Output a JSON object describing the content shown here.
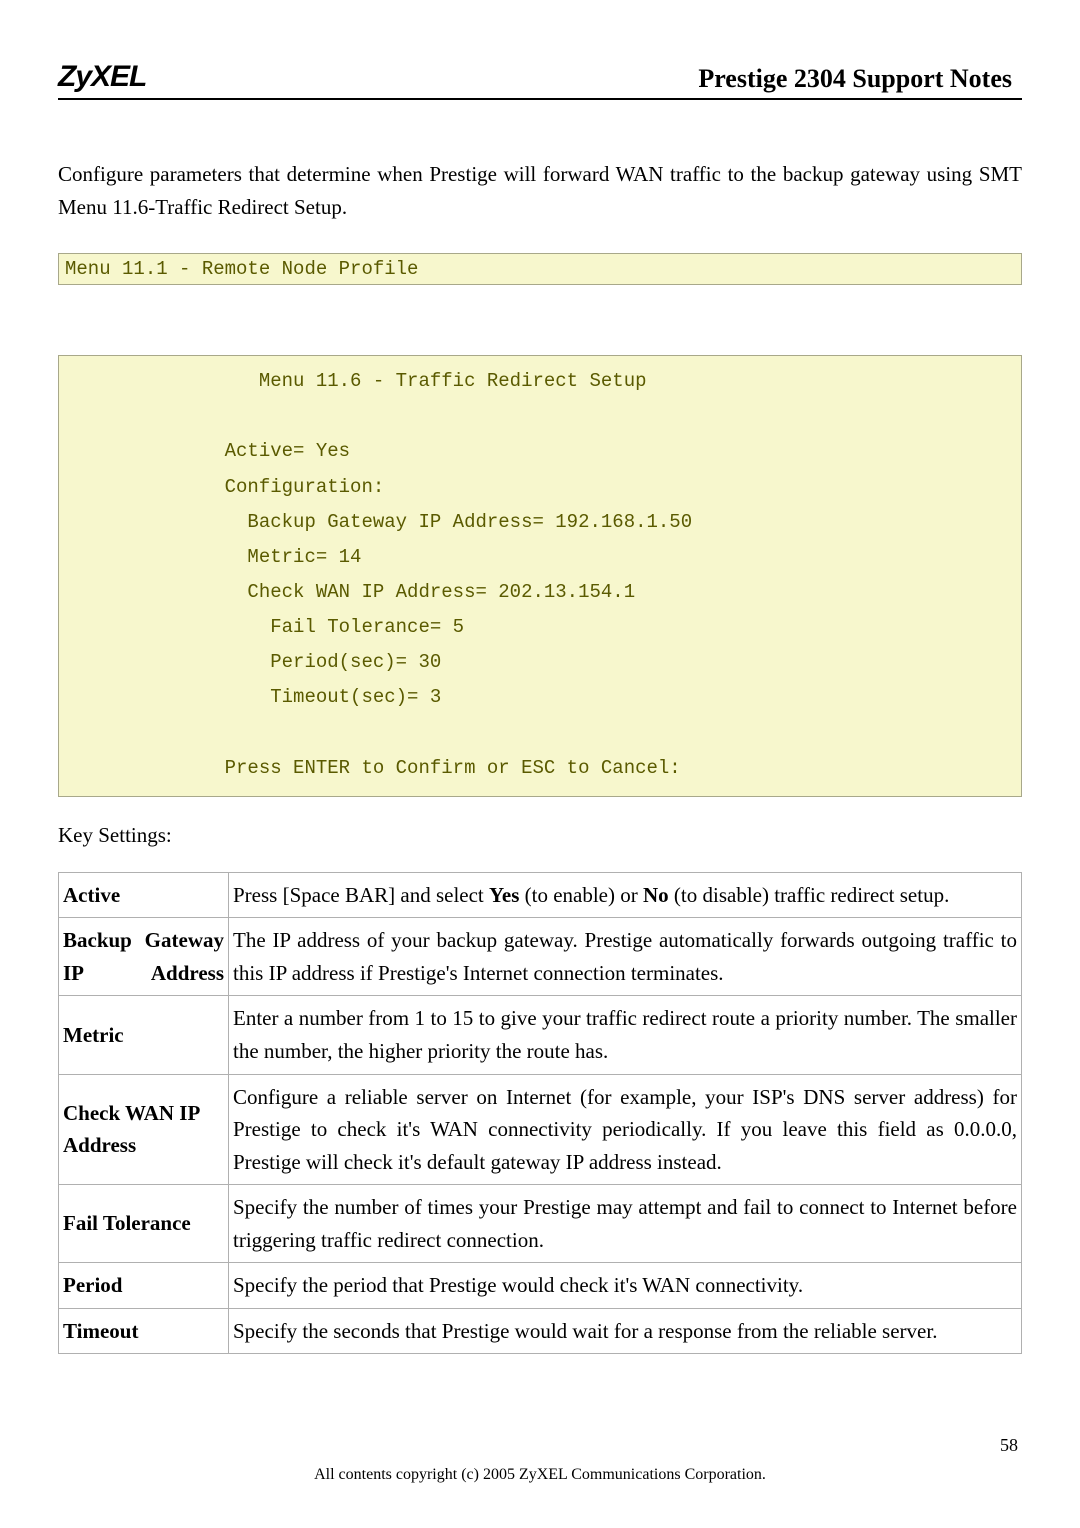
{
  "header": {
    "logo": "ZyXEL",
    "title": "Prestige 2304 Support Notes"
  },
  "intro": {
    "line1": "Configure parameters that determine when Prestige will forward WAN traffic to the backup gateway using ",
    "line2_bold": "SMT Menu 11.6-Traffic Redirect Setup."
  },
  "code_strip": "Menu 11.1 - Remote Node Profile",
  "code_block": "                 Menu 11.6 - Traffic Redirect Setup\n\n              Active= Yes\n              Configuration:\n                Backup Gateway IP Address= 192.168.1.50\n                Metric= 14\n                Check WAN IP Address= 202.13.154.1\n                  Fail Tolerance= 5\n                  Period(sec)= 30\n                  Timeout(sec)= 3\n\n              Press ENTER to Confirm or ESC to Cancel:",
  "key_settings_label": "Key Settings:",
  "rows": [
    {
      "term": "Active",
      "desc_pre": "Press [Space BAR] and select ",
      "desc_b1": "Yes",
      "desc_mid": " (to enable) or ",
      "desc_b2": "No",
      "desc_post": " (to disable) traffic redirect setup."
    },
    {
      "term": "Backup Gateway IP Address",
      "desc": "The IP address of your backup gateway. Prestige automatically forwards outgoing traffic to this IP address if Prestige's Internet connection terminates."
    },
    {
      "term": "Metric",
      "desc": "Enter a number from 1 to 15 to give your traffic redirect route a priority number. The smaller the number, the higher priority the route has."
    },
    {
      "term": "Check WAN IP Address",
      "desc": "Configure a reliable server on Internet (for example, your ISP's DNS server address) for Prestige to check it's WAN connectivity periodically. If you leave this field as 0.0.0.0, Prestige will check it's default gateway IP address instead."
    },
    {
      "term": "Fail Tolerance",
      "desc": "Specify the number of times your Prestige may attempt and fail to connect to Internet before triggering traffic redirect connection."
    },
    {
      "term": "Period",
      "desc": "Specify the period that Prestige would check it's WAN connectivity."
    },
    {
      "term": "Timeout",
      "desc": "Specify the seconds that Prestige would wait for a response from the reliable server."
    }
  ],
  "footer": "All contents copyright (c) 2005 ZyXEL Communications Corporation.",
  "page_num": "58"
}
